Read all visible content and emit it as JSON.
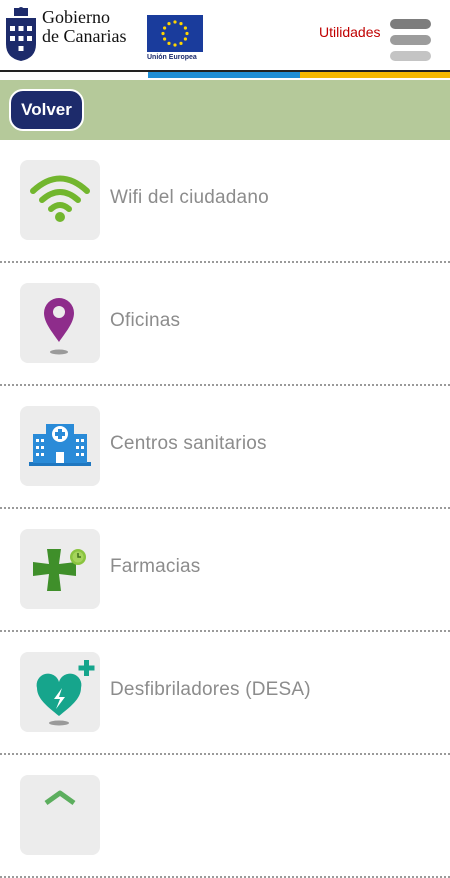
{
  "header": {
    "gobierno_line1": "Gobierno",
    "gobierno_line2": "de Canarias",
    "eu_label": "Unión Europea",
    "utilidades_label": "Utilidades"
  },
  "subbar": {
    "back_label": "Volver"
  },
  "items": [
    {
      "label": "Wifi del ciudadano",
      "icon": "wifi-icon"
    },
    {
      "label": "Oficinas",
      "icon": "map-pin-icon"
    },
    {
      "label": "Centros sanitarios",
      "icon": "hospital-icon"
    },
    {
      "label": "Farmacias",
      "icon": "pharmacy-cross-icon"
    },
    {
      "label": "Desfibriladores (DESA)",
      "icon": "defibrillator-heart-icon"
    },
    {
      "label": "",
      "icon": "house-icon"
    }
  ],
  "colors": {
    "accent_red": "#c00000",
    "navy": "#1d2b6b",
    "subbar_green": "#b5c99a",
    "stripe_blue": "#1f8ed6",
    "stripe_yellow": "#f5b800"
  }
}
